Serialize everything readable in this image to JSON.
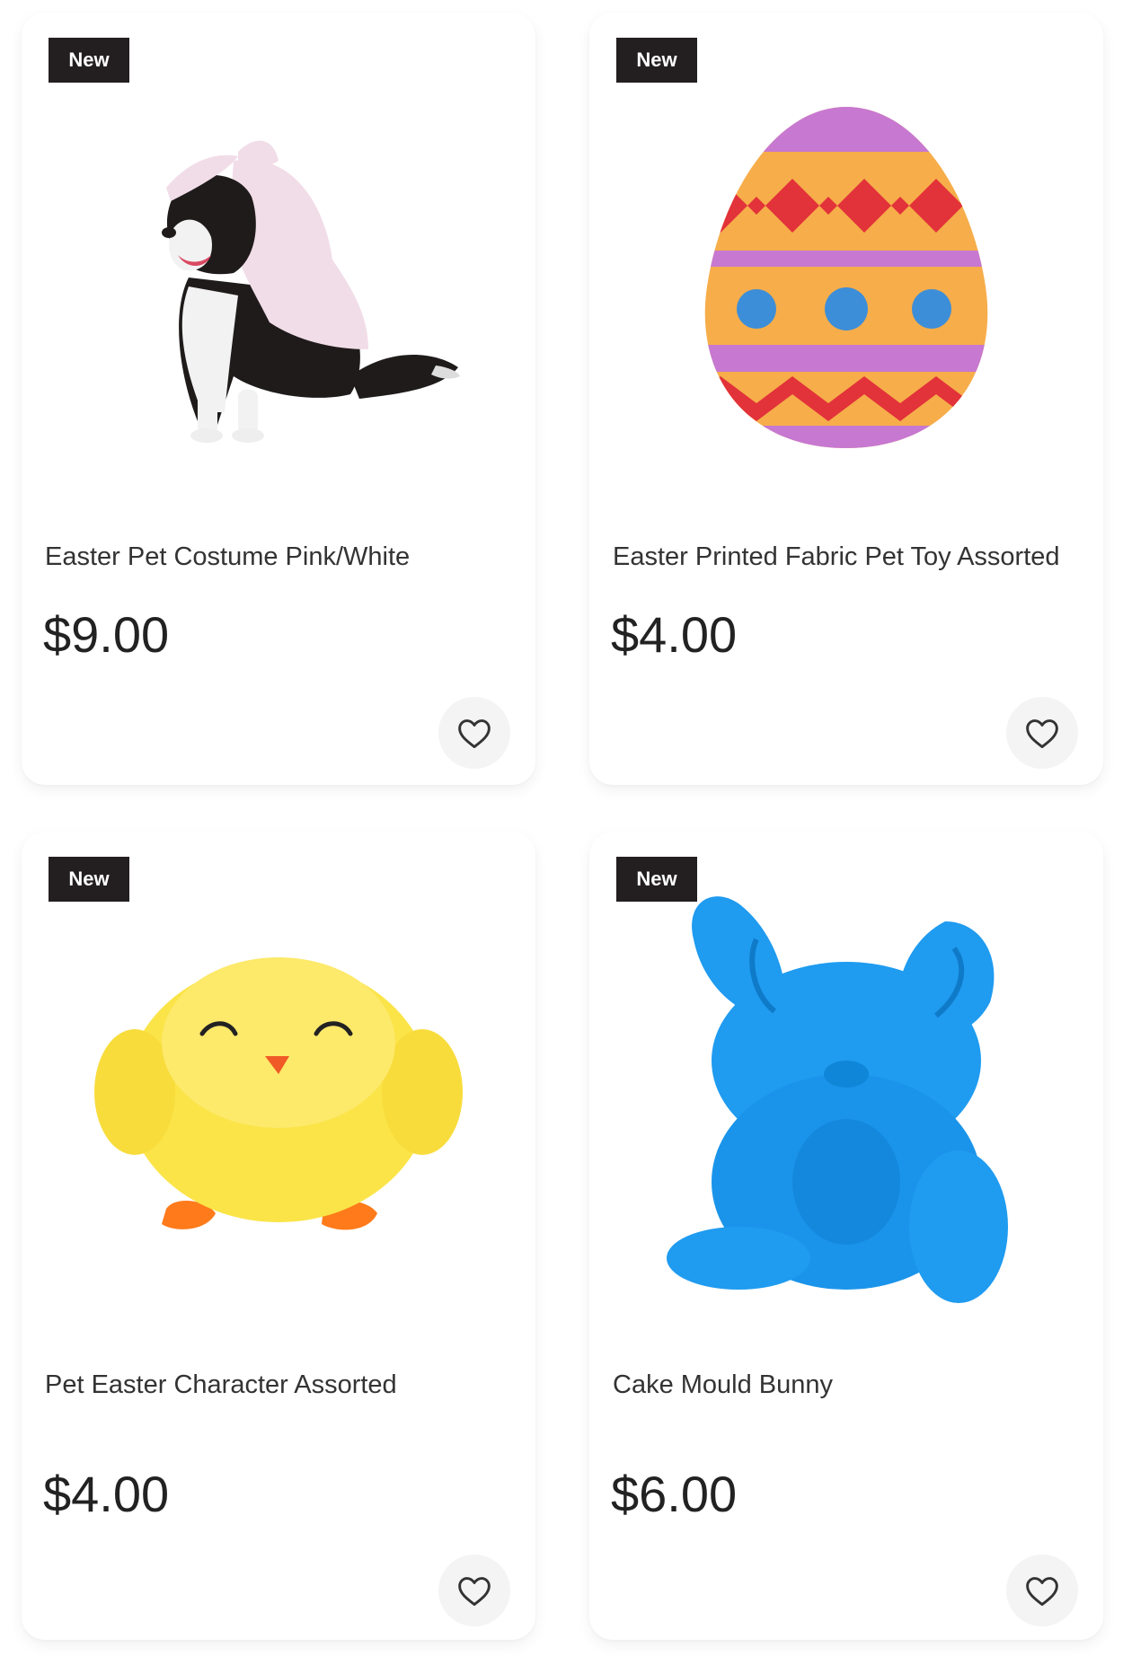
{
  "products": [
    {
      "badge": "New",
      "name": "Easter Pet Costume Pink/White",
      "price": "$9.00",
      "image": "dog-in-pink-bunny-costume"
    },
    {
      "badge": "New",
      "name": "Easter Printed Fabric Pet Toy Assorted",
      "price": "$4.00",
      "image": "easter-egg-plush-toy"
    },
    {
      "badge": "New",
      "name": "Pet Easter Character Assorted",
      "price": "$4.00",
      "image": "yellow-chick-plush"
    },
    {
      "badge": "New",
      "name": "Cake Mould Bunny",
      "price": "$6.00",
      "image": "blue-silicone-bunny-mould"
    }
  ],
  "icons": {
    "favorite": "heart-outline-icon"
  },
  "colors": {
    "badge_bg": "#231f20",
    "badge_text": "#ffffff",
    "price_text": "#222222",
    "fav_bg": "#f4f4f4"
  }
}
